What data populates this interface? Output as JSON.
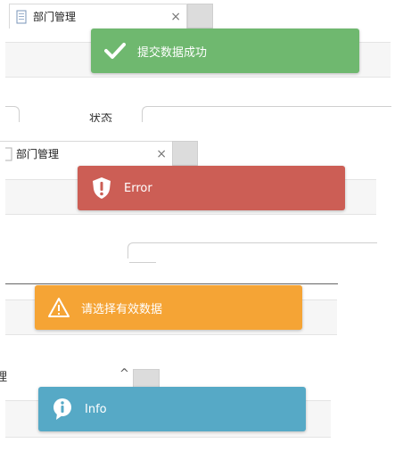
{
  "tab": {
    "label": "部门管理",
    "close": "×"
  },
  "fragments": {
    "status_text": "状态",
    "manage_text": "理",
    "caret": "^"
  },
  "toasts": [
    {
      "label": "提交数据成功",
      "type": "success",
      "color": "#6fb86f",
      "icon": "check-icon"
    },
    {
      "label": "Error",
      "type": "error",
      "color": "#cc5e55",
      "icon": "shield-exclamation-icon"
    },
    {
      "label": "请选择有效数据",
      "type": "warning",
      "color": "#f5a435",
      "icon": "warning-triangle-icon"
    },
    {
      "label": "Info",
      "type": "info",
      "color": "#56a9c6",
      "icon": "info-speech-icon"
    }
  ]
}
